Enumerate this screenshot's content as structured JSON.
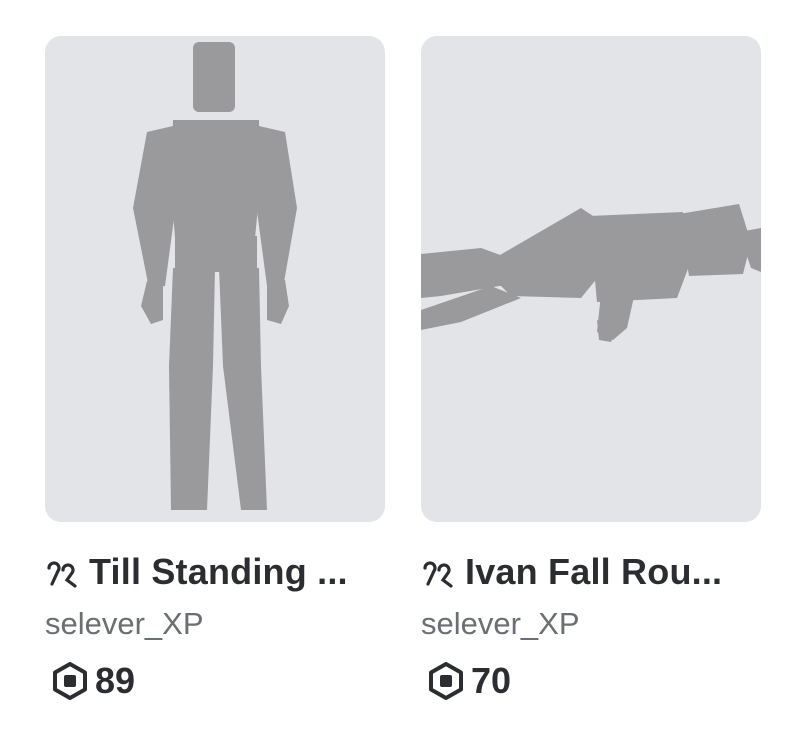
{
  "items": [
    {
      "name": "Till Standing ...",
      "creator": "selever_XP",
      "price": "89",
      "thumbnail_icon": "standing-avatar-silhouette"
    },
    {
      "name": "Ivan Fall Rou...",
      "creator": "selever_XP",
      "price": "70",
      "thumbnail_icon": "falling-avatar-silhouette"
    }
  ],
  "icons": {
    "bundle": "bundle-icon",
    "currency": "robux-icon"
  },
  "colors": {
    "thumbnail_bg": "#e3e4e7",
    "silhouette": "#9a9a9c",
    "title_text": "#2b2d30",
    "creator_text": "#6b6e73"
  }
}
